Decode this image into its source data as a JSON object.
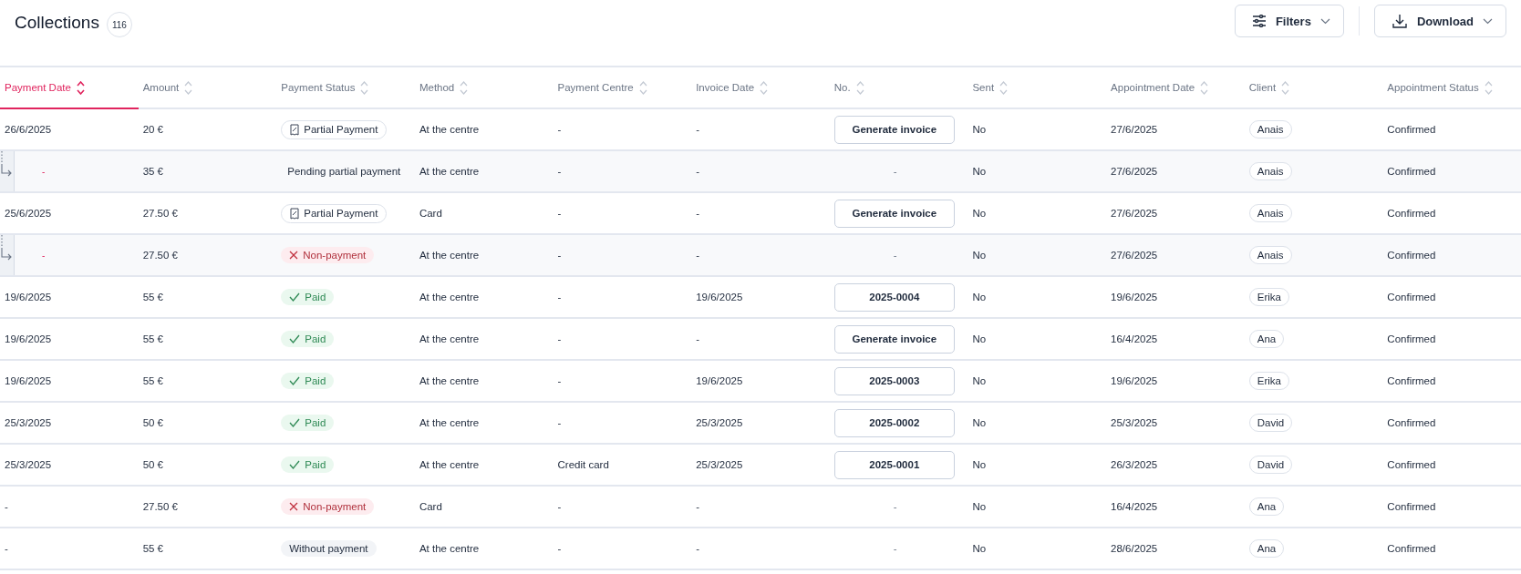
{
  "page": {
    "title": "Collections",
    "count": "116"
  },
  "toolbar": {
    "buttons": [
      {
        "label": "Filters",
        "kind": "filters"
      },
      {
        "label": "Download",
        "kind": "download"
      }
    ]
  },
  "table": {
    "columns": [
      {
        "label": "Payment Date",
        "selected": true
      },
      {
        "label": "Amount",
        "selected": false
      },
      {
        "label": "Payment Status",
        "selected": false
      },
      {
        "label": "Method",
        "selected": false
      },
      {
        "label": "Payment Centre",
        "selected": false
      },
      {
        "label": "Invoice Date",
        "selected": false
      },
      {
        "label": "No.",
        "selected": false
      },
      {
        "label": "Sent",
        "selected": false
      },
      {
        "label": "Appointment Date",
        "selected": false
      },
      {
        "label": "Client",
        "selected": false
      },
      {
        "label": "Appointment Status",
        "selected": false
      }
    ],
    "rows": [
      {
        "kind": "main",
        "payment_date": "26/6/2025",
        "amount": "20 €",
        "payment_status": {
          "label": "Partial Payment",
          "kind": "partial"
        },
        "method": "At the centre",
        "payment_centre": "-",
        "invoice_date": "-",
        "number": {
          "label": "Generate invoice",
          "kind": "button"
        },
        "sent": "No",
        "appointment_date": "27/6/2025",
        "client": "Anais",
        "appointment_status": "Confirmed"
      },
      {
        "kind": "sub",
        "payment_date": "-",
        "amount": "35 €",
        "payment_status": {
          "label": "Pending partial payment",
          "kind": "pending"
        },
        "method": "At the centre",
        "payment_centre": "-",
        "invoice_date": "-",
        "number": {
          "label": "-",
          "kind": "text"
        },
        "sent": "No",
        "appointment_date": "27/6/2025",
        "client": "Anais",
        "appointment_status": "Confirmed"
      },
      {
        "kind": "main",
        "payment_date": "25/6/2025",
        "amount": "27.50 €",
        "payment_status": {
          "label": "Partial Payment",
          "kind": "partial"
        },
        "method": "Card",
        "payment_centre": "-",
        "invoice_date": "-",
        "number": {
          "label": "Generate invoice",
          "kind": "button"
        },
        "sent": "No",
        "appointment_date": "27/6/2025",
        "client": "Anais",
        "appointment_status": "Confirmed"
      },
      {
        "kind": "sub",
        "payment_date": "-",
        "amount": "27.50 €",
        "payment_status": {
          "label": "Non-payment",
          "kind": "nonpayment"
        },
        "method": "At the centre",
        "payment_centre": "-",
        "invoice_date": "-",
        "number": {
          "label": "-",
          "kind": "text"
        },
        "sent": "No",
        "appointment_date": "27/6/2025",
        "client": "Anais",
        "appointment_status": "Confirmed"
      },
      {
        "kind": "main",
        "payment_date": "19/6/2025",
        "amount": "55 €",
        "payment_status": {
          "label": "Paid",
          "kind": "paid"
        },
        "method": "At the centre",
        "payment_centre": "-",
        "invoice_date": "19/6/2025",
        "number": {
          "label": "2025-0004",
          "kind": "button"
        },
        "sent": "No",
        "appointment_date": "19/6/2025",
        "client": "Erika",
        "appointment_status": "Confirmed"
      },
      {
        "kind": "main",
        "payment_date": "19/6/2025",
        "amount": "55 €",
        "payment_status": {
          "label": "Paid",
          "kind": "paid"
        },
        "method": "At the centre",
        "payment_centre": "-",
        "invoice_date": "-",
        "number": {
          "label": "Generate invoice",
          "kind": "button"
        },
        "sent": "No",
        "appointment_date": "16/4/2025",
        "client": "Ana",
        "appointment_status": "Confirmed"
      },
      {
        "kind": "main",
        "payment_date": "19/6/2025",
        "amount": "55 €",
        "payment_status": {
          "label": "Paid",
          "kind": "paid"
        },
        "method": "At the centre",
        "payment_centre": "-",
        "invoice_date": "19/6/2025",
        "number": {
          "label": "2025-0003",
          "kind": "button"
        },
        "sent": "No",
        "appointment_date": "19/6/2025",
        "client": "Erika",
        "appointment_status": "Confirmed"
      },
      {
        "kind": "main",
        "payment_date": "25/3/2025",
        "amount": "50 €",
        "payment_status": {
          "label": "Paid",
          "kind": "paid"
        },
        "method": "At the centre",
        "payment_centre": "-",
        "invoice_date": "25/3/2025",
        "number": {
          "label": "2025-0002",
          "kind": "button"
        },
        "sent": "No",
        "appointment_date": "25/3/2025",
        "client": "David",
        "appointment_status": "Confirmed"
      },
      {
        "kind": "main",
        "payment_date": "25/3/2025",
        "amount": "50 €",
        "payment_status": {
          "label": "Paid",
          "kind": "paid"
        },
        "method": "At the centre",
        "payment_centre": "Credit card",
        "invoice_date": "25/3/2025",
        "number": {
          "label": "2025-0001",
          "kind": "button"
        },
        "sent": "No",
        "appointment_date": "26/3/2025",
        "client": "David",
        "appointment_status": "Confirmed"
      },
      {
        "kind": "main",
        "payment_date": "-",
        "amount": "27.50 €",
        "payment_status": {
          "label": "Non-payment",
          "kind": "nonpayment"
        },
        "method": "Card",
        "payment_centre": "-",
        "invoice_date": "-",
        "number": {
          "label": "-",
          "kind": "text"
        },
        "sent": "No",
        "appointment_date": "16/4/2025",
        "client": "Ana",
        "appointment_status": "Confirmed"
      },
      {
        "kind": "main",
        "payment_date": "-",
        "amount": "55 €",
        "payment_status": {
          "label": "Without payment",
          "kind": "none"
        },
        "method": "At the centre",
        "payment_centre": "-",
        "invoice_date": "-",
        "number": {
          "label": "-",
          "kind": "text"
        },
        "sent": "No",
        "appointment_date": "28/6/2025",
        "client": "Ana",
        "appointment_status": "Confirmed"
      }
    ]
  }
}
